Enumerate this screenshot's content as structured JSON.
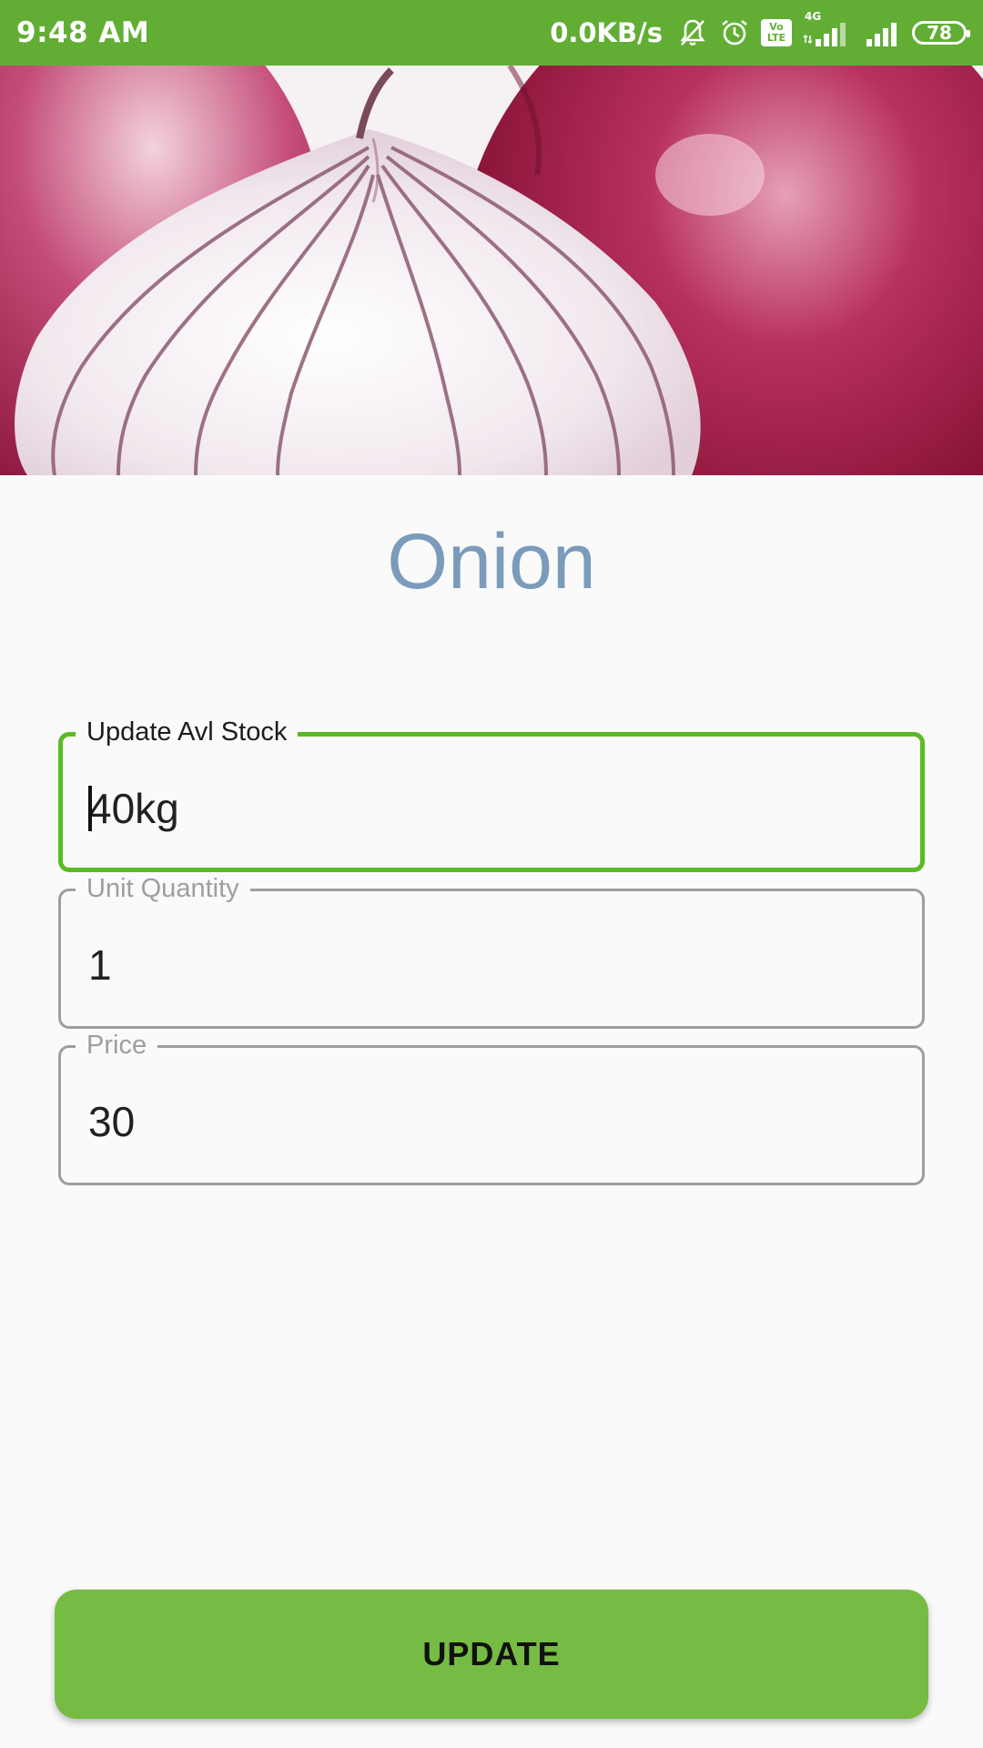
{
  "status_bar": {
    "time": "9:48 AM",
    "network_speed": "0.0KB/s",
    "network_type": "4G",
    "volte_top": "Vo",
    "volte_bottom": "LTE",
    "battery_level": "78",
    "icons": [
      "bell-off-icon",
      "alarm-icon",
      "volte-icon",
      "signal-4g-icon",
      "signal-icon",
      "battery-icon"
    ],
    "background_color": "#62ae34"
  },
  "hero_image": {
    "subject": "onion-image"
  },
  "product": {
    "name": "Onion",
    "title_color": "#7b9bbb"
  },
  "form": {
    "stock": {
      "label": "Update Avl Stock",
      "value": "40kg",
      "focused": true,
      "accent_color": "#5bba25"
    },
    "unit_quantity": {
      "label": "Unit Quantity",
      "value": "1"
    },
    "price": {
      "label": "Price",
      "value": "30"
    }
  },
  "actions": {
    "update_label": "UPDATE",
    "button_color": "#76bb43"
  }
}
